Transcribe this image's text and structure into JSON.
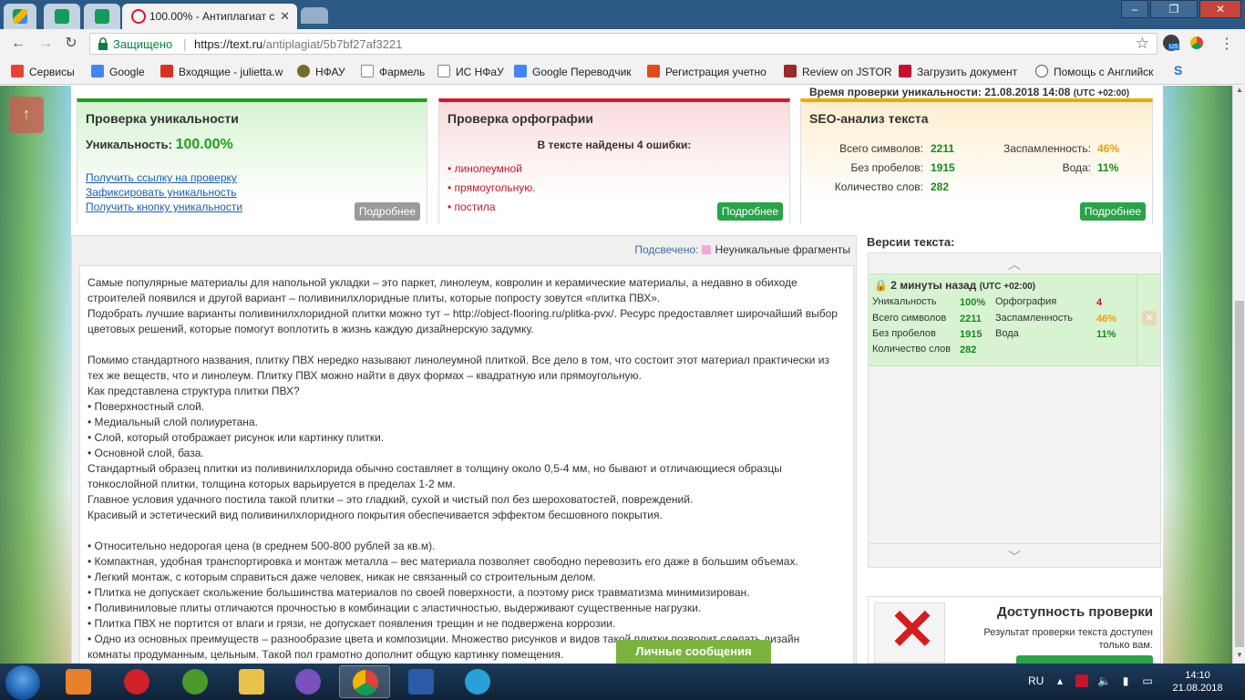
{
  "browser": {
    "tabs": [
      {
        "title": "",
        "icon": "drive-icon"
      },
      {
        "title": "",
        "icon": "sheets-icon"
      },
      {
        "title": "",
        "icon": "sheets-icon"
      },
      {
        "title": "100.00% - Антиплагиат с",
        "icon": "textru-icon"
      },
      {
        "title": "",
        "icon": "new-tab"
      }
    ],
    "window_buttons": {
      "minimize": "–",
      "restore": "❐",
      "close": "✕"
    },
    "secure_label": "Защищено",
    "url_host": "https://text.ru",
    "url_path": "/antiplagiat/5b7bf27af3221",
    "profile_badge": "US"
  },
  "bookmarks": [
    {
      "label": "Сервисы",
      "color": "#e94235"
    },
    {
      "label": "Google",
      "color": "#4285f4"
    },
    {
      "label": "Входящие - julietta.w",
      "color": "#d93025"
    },
    {
      "label": "НФАУ",
      "color": "#7a6a2a"
    },
    {
      "label": "Фармель",
      "color": "#ffffff"
    },
    {
      "label": "ИС НФаУ",
      "color": "#ffffff"
    },
    {
      "label": "Google Переводчик",
      "color": "#4285f4"
    },
    {
      "label": "Регистрация учетно",
      "color": "#e24a1a"
    },
    {
      "label": "Review on JSTOR",
      "color": "#9a2a2a"
    },
    {
      "label": "Загрузить документ",
      "color": "#c8102e"
    },
    {
      "label": "Помощь с Английск",
      "color": "#ffffff"
    },
    {
      "label": "S",
      "color": "#1a73e8"
    }
  ],
  "page": {
    "check_time_label": "Время проверки уникальности:",
    "check_time_value": "21.08.2018 14:08",
    "check_time_tz": "(UTC +02:00)",
    "uniqueness": {
      "title": "Проверка уникальности",
      "label": "Уникальность:",
      "value": "100.00%",
      "links": [
        "Получить ссылку на проверку",
        "Зафиксировать уникальность",
        "Получить кнопку уникальности"
      ],
      "more": "Подробнее",
      "color": "#1aa01a"
    },
    "orthography": {
      "title": "Проверка орфографии",
      "subtitle": "В тексте найдены 4 ошибки:",
      "errors": [
        "• линолеумной",
        "• прямоугольную.",
        "• постила"
      ],
      "more": "Подробнее",
      "color": "#d9152c"
    },
    "seo": {
      "title": "SEO-анализ текста",
      "rows": [
        {
          "label": "Всего символов:",
          "value": "2211"
        },
        {
          "label": "Без пробелов:",
          "value": "1915"
        },
        {
          "label": "Количество слов:",
          "value": "282"
        }
      ],
      "rows_right": [
        {
          "label": "Заспамленность:",
          "value": "46%"
        },
        {
          "label": "Вода:",
          "value": "11%"
        }
      ],
      "more": "Подробнее",
      "color": "#f0a800"
    },
    "highlight_label": "Подсвечено:",
    "highlight_value": "Неуникальные фрагменты",
    "text": "Самые популярные материалы для напольной укладки – это паркет, линолеум, ковролин и керамические материалы, а недавно в обиходе строителей появился и другой вариант – поливинилхлоридные плиты, которые попросту зовутся «плитка ПВХ».\nПодобрать лучшие варианты поливинилхлоридной плитки можно тут – http://object-flooring.ru/plitka-pvx/. Ресурс предоставляет широчайший выбор цветовых решений, которые помогут воплотить в жизнь каждую дизайнерскую задумку.\n\nПомимо стандартного названия, плитку ПВХ нередко называют линолеумной плиткой. Все дело в том, что состоит этот материал практически из тех же веществ, что и линолеум. Плитку ПВХ можно найти в двух формах – квадратную или прямоугольную.\nКак представлена структура плитки ПВХ?\n• Поверхностный слой.\n• Медиальный слой полиуретана.\n• Слой, который отображает рисунок или картинку плитки.\n• Основной слой, база.\nСтандартный образец плитки из поливинилхлорида обычно составляет в толщину около 0,5-4 мм, но бывают и отличающиеся образцы тонкослойной плитки, толщина которых варьируется в пределах 1-2 мм.\nГлавное условия удачного постила такой плитки – это гладкий, сухой и чистый пол без шероховатостей, повреждений.\nКрасивый и эстетический вид поливинилхлоридного покрытия обеспечивается эффектом бесшовного покрытия.\n\n• Относительно недорогая цена (в среднем 500-800 рублей за кв.м).\n• Компактная, удобная транспортировка и монтаж металла – вес материала позволяет свободно перевозить его даже в большим объемах.\n• Легкий монтаж, с которым справиться даже человек, никак не связанный со строительным делом.\n• Плитка не допускает скольжение большинства материалов по своей поверхности, а поэтому риск травматизма минимизирован.\n• Поливиниловые плиты отличаются прочностью в комбинации с эластичностью, выдерживают существенные нагрузки.\n• Плитка ПВХ не портится от влаги и грязи, не допускает появления трещин и не подвержена коррозии.\n• Одно из основных преимуществ – разнообразие цвета и композиции. Множество рисунков и видов такой плитки позволит сделать дизайн комнаты продуманным, цельным. Такой пол грамотно дополнит общую картинку помещения.",
    "versions": {
      "title": "Версии текста:",
      "item": {
        "time": "2 минуты назад",
        "tz": "(UTC +02:00)",
        "uniq_label": "Уникальность",
        "uniq_value": "100%",
        "chars_label": "Всего символов",
        "chars_value": "2211",
        "nospace_label": "Без пробелов",
        "nospace_value": "1915",
        "words_label": "Количество слов",
        "words_value": "282",
        "orth_label": "Орфография",
        "orth_value": "4",
        "spam_label": "Заспамленность",
        "spam_value": "46%",
        "water_label": "Вода",
        "water_value": "11%"
      }
    },
    "availability": {
      "title": "Доступность проверки",
      "text": "Результат проверки текста доступен только вам."
    },
    "messages_button": "Личные сообщения"
  },
  "taskbar": {
    "apps": [
      {
        "name": "media-player",
        "color": "#e8812a"
      },
      {
        "name": "opera",
        "color": "#d0202a"
      },
      {
        "name": "utorrent",
        "color": "#4a9a2a"
      },
      {
        "name": "explorer",
        "color": "#e8c24a"
      },
      {
        "name": "viber",
        "color": "#7a4fbf"
      },
      {
        "name": "chrome",
        "color": "#3a8ad8"
      },
      {
        "name": "word",
        "color": "#2a5aa8"
      },
      {
        "name": "telegram",
        "color": "#2aa0d8"
      }
    ],
    "lang": "RU",
    "time": "14:10",
    "date": "21.08.2018"
  }
}
